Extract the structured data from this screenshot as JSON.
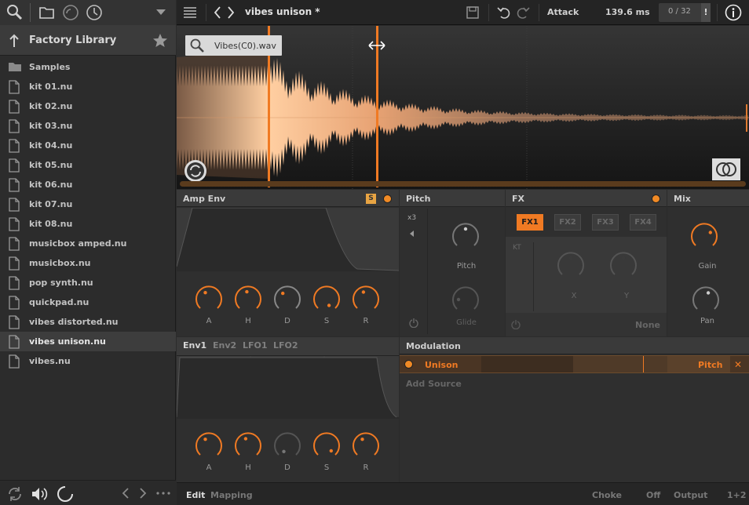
{
  "sidebar": {
    "library_title": "Factory Library",
    "items": [
      {
        "label": "Samples",
        "kind": "folder"
      },
      {
        "label": "kit 01.nu",
        "kind": "file"
      },
      {
        "label": "kit 02.nu",
        "kind": "file"
      },
      {
        "label": "kit 03.nu",
        "kind": "file"
      },
      {
        "label": "kit 04.nu",
        "kind": "file"
      },
      {
        "label": "kit 05.nu",
        "kind": "file"
      },
      {
        "label": "kit 06.nu",
        "kind": "file"
      },
      {
        "label": "kit 07.nu",
        "kind": "file"
      },
      {
        "label": "kit 08.nu",
        "kind": "file"
      },
      {
        "label": "musicbox amped.nu",
        "kind": "file"
      },
      {
        "label": "musicbox.nu",
        "kind": "file"
      },
      {
        "label": "pop synth.nu",
        "kind": "file"
      },
      {
        "label": "quickpad.nu",
        "kind": "file"
      },
      {
        "label": "vibes distorted.nu",
        "kind": "file"
      },
      {
        "label": "vibes unison.nu",
        "kind": "file",
        "selected": true
      },
      {
        "label": "vibes.nu",
        "kind": "file"
      }
    ]
  },
  "toolbar": {
    "title": "vibes unison *",
    "param_name": "Attack",
    "param_value": "139.6 ms",
    "voice_count": "0 / 32",
    "voice_warn": "!"
  },
  "waveform": {
    "file_name": "Vibes(C0).wav"
  },
  "amp_env": {
    "title": "Amp Env",
    "solo_label": "S",
    "knobs": [
      "A",
      "H",
      "D",
      "S",
      "R"
    ]
  },
  "pitch": {
    "title": "Pitch",
    "x3": "x3",
    "pitch_label": "Pitch",
    "glide_label": "Glide"
  },
  "fx": {
    "title": "FX",
    "tabs": [
      "FX1",
      "FX2",
      "FX3",
      "FX4"
    ],
    "kt": "KT",
    "x_label": "X",
    "y_label": "Y",
    "none_label": "None"
  },
  "mix": {
    "title": "Mix",
    "gain_label": "Gain",
    "pan_label": "Pan"
  },
  "env_tabs": {
    "tabs": [
      "Env1",
      "Env2",
      "LFO1",
      "LFO2"
    ],
    "knobs": [
      "A",
      "H",
      "D",
      "S",
      "R"
    ]
  },
  "modulation": {
    "title": "Modulation",
    "source": "Unison",
    "target": "Pitch",
    "close": "✕",
    "add_source": "Add Source"
  },
  "bottom": {
    "edit": "Edit",
    "mapping": "Mapping",
    "choke": "Choke",
    "choke_val": "Off",
    "output": "Output",
    "output_val": "1+2"
  },
  "colors": {
    "accent": "#f07a23",
    "bg": "#2b2b2b"
  }
}
